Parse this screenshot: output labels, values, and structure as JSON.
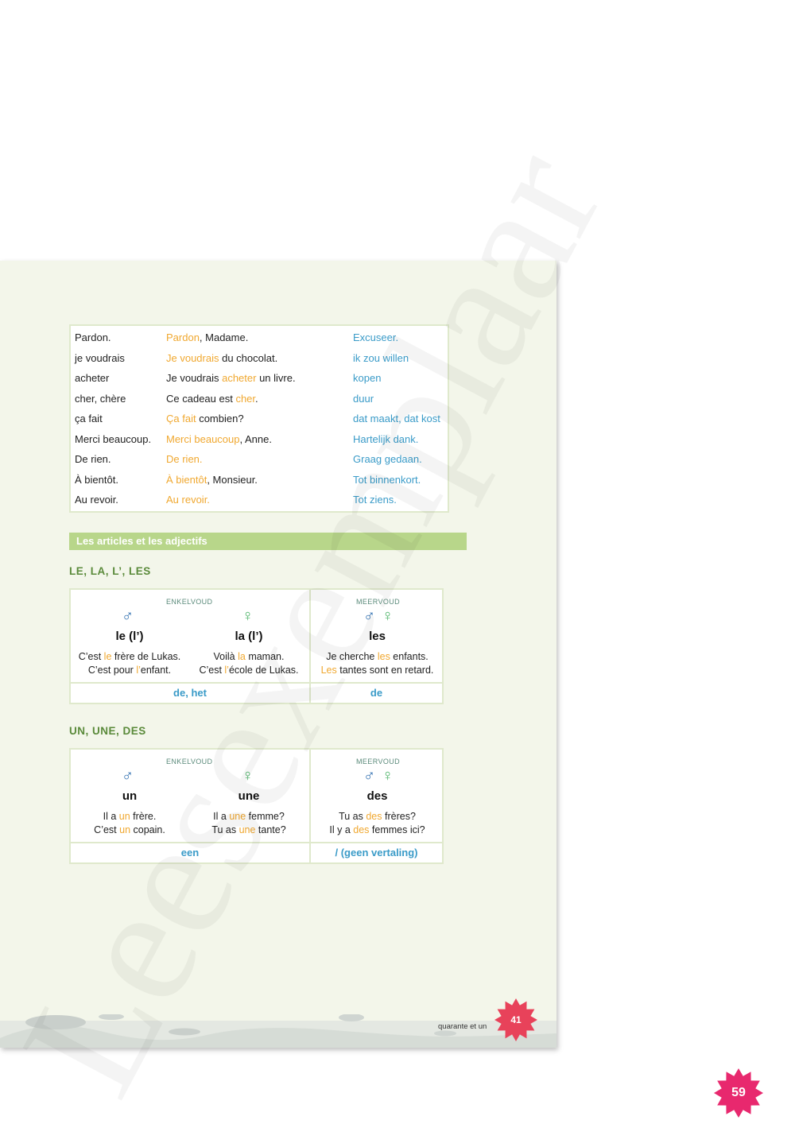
{
  "vocab": [
    {
      "fr": "Pardon.",
      "example": [
        {
          "t": "Pardon",
          "h": true
        },
        {
          "t": ", Madame.",
          "h": false
        }
      ],
      "nl": "Excuseer."
    },
    {
      "fr": "je voudrais",
      "example": [
        {
          "t": "Je voudrais",
          "h": true
        },
        {
          "t": " du chocolat.",
          "h": false
        }
      ],
      "nl": "ik zou willen"
    },
    {
      "fr": "acheter",
      "example": [
        {
          "t": "Je voudrais ",
          "h": false
        },
        {
          "t": "acheter",
          "h": true
        },
        {
          "t": " un livre.",
          "h": false
        }
      ],
      "nl": "kopen"
    },
    {
      "fr": "cher, chère",
      "example": [
        {
          "t": "Ce cadeau est ",
          "h": false
        },
        {
          "t": "cher",
          "h": true
        },
        {
          "t": ".",
          "h": false
        }
      ],
      "nl": "duur"
    },
    {
      "fr": "ça fait",
      "example": [
        {
          "t": "Ça fait",
          "h": true
        },
        {
          "t": " combien?",
          "h": false
        }
      ],
      "nl": "dat maakt, dat kost"
    },
    {
      "fr": "Merci beaucoup.",
      "example": [
        {
          "t": "Merci beaucoup",
          "h": true
        },
        {
          "t": ", Anne.",
          "h": false
        }
      ],
      "nl": "Hartelijk dank."
    },
    {
      "fr": "De rien.",
      "example": [
        {
          "t": "De rien.",
          "h": true
        }
      ],
      "nl": "Graag gedaan."
    },
    {
      "fr": "À bientôt.",
      "example": [
        {
          "t": "À bientôt",
          "h": true
        },
        {
          "t": ", Monsieur.",
          "h": false
        }
      ],
      "nl": "Tot binnenkort."
    },
    {
      "fr": "Au revoir.",
      "example": [
        {
          "t": "Au revoir.",
          "h": true
        }
      ],
      "nl": "Tot ziens."
    }
  ],
  "section_title": "Les articles et les adjectifs",
  "definite": {
    "heading": "LE, LA, L’, LES",
    "singular_caption": "ENKELVOUD",
    "plural_caption": "MEERVOUD",
    "male_symbol": "♂",
    "female_symbol": "♀",
    "m_article": "le (l’)",
    "f_article": "la (l’)",
    "pl_article": "les",
    "m_examples": [
      [
        {
          "t": "C’est ",
          "h": false
        },
        {
          "t": "le",
          "h": true
        },
        {
          "t": " frère de Lukas.",
          "h": false
        }
      ],
      [
        {
          "t": "C’est pour ",
          "h": false
        },
        {
          "t": "l’",
          "h": true
        },
        {
          "t": "enfant.",
          "h": false
        }
      ]
    ],
    "f_examples": [
      [
        {
          "t": "Voilà ",
          "h": false
        },
        {
          "t": "la",
          "h": true
        },
        {
          "t": " maman.",
          "h": false
        }
      ],
      [
        {
          "t": "C’est ",
          "h": false
        },
        {
          "t": "l’",
          "h": true
        },
        {
          "t": "école de Lukas.",
          "h": false
        }
      ]
    ],
    "pl_examples": [
      [
        {
          "t": "Je cherche ",
          "h": false
        },
        {
          "t": "les",
          "h": true
        },
        {
          "t": " enfants.",
          "h": false
        }
      ],
      [
        {
          "t": "Les",
          "h": true
        },
        {
          "t": " tantes sont en retard.",
          "h": false
        }
      ]
    ],
    "sg_translation": "de, het",
    "pl_translation": "de"
  },
  "indefinite": {
    "heading": "UN, UNE, DES",
    "singular_caption": "ENKELVOUD",
    "plural_caption": "MEERVOUD",
    "male_symbol": "♂",
    "female_symbol": "♀",
    "m_article": "un",
    "f_article": "une",
    "pl_article": "des",
    "m_examples": [
      [
        {
          "t": "Il a ",
          "h": false
        },
        {
          "t": "un",
          "h": true
        },
        {
          "t": " frère.",
          "h": false
        }
      ],
      [
        {
          "t": "C’est ",
          "h": false
        },
        {
          "t": "un",
          "h": true
        },
        {
          "t": " copain.",
          "h": false
        }
      ]
    ],
    "f_examples": [
      [
        {
          "t": "Il a ",
          "h": false
        },
        {
          "t": "une",
          "h": true
        },
        {
          "t": " femme?",
          "h": false
        }
      ],
      [
        {
          "t": "Tu as ",
          "h": false
        },
        {
          "t": "une",
          "h": true
        },
        {
          "t": " tante?",
          "h": false
        }
      ]
    ],
    "pl_examples": [
      [
        {
          "t": "Tu as ",
          "h": false
        },
        {
          "t": "des",
          "h": true
        },
        {
          "t": " frères?",
          "h": false
        }
      ],
      [
        {
          "t": "Il y a ",
          "h": false
        },
        {
          "t": "des",
          "h": true
        },
        {
          "t": " femmes ici?",
          "h": false
        }
      ]
    ],
    "sg_translation": "een",
    "pl_translation": "/ (geen vertaling)"
  },
  "inner_page": {
    "number_words": "quarante et un",
    "number": "41"
  },
  "outer_page_number": "59",
  "watermark": "Leesexemplaar",
  "colors": {
    "highlight": "#f0a830",
    "translation": "#3a9bc8",
    "heading_green": "#5a8a3a",
    "badge_pink": "#e8286e",
    "badge_red": "#e8425a"
  }
}
